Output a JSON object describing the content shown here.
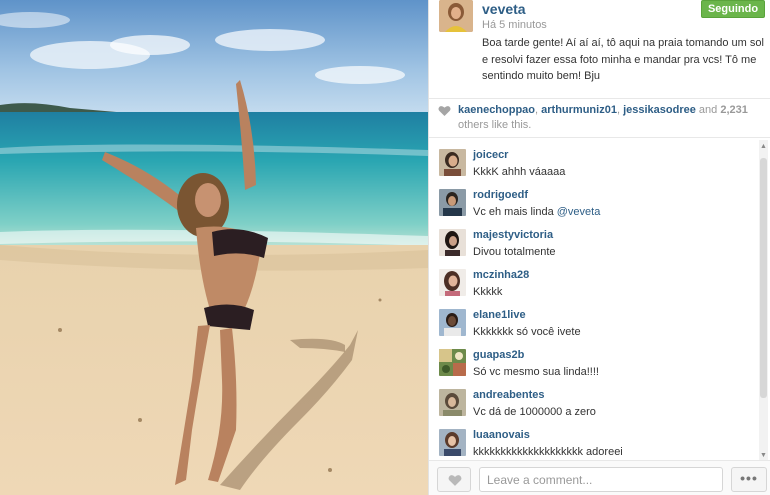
{
  "post": {
    "username": "veveta",
    "time": "Há 5 minutos",
    "follow_label": "Seguindo",
    "caption": "Boa tarde gente! Aí aí aí, tô aqui na praia tomando um sol e resolvi fazer essa foto minha e mandar pra vcs! Tô me sentindo muito bem! Bju"
  },
  "likes": {
    "users": [
      "kaenechoppao",
      "arthurmuniz01",
      "jessikasodree"
    ],
    "sep": ", ",
    "and": " and ",
    "count": "2,231",
    "suffix": " others like this."
  },
  "comments": [
    {
      "user": "joicecr",
      "text": "KkkK ahhh váaaaa",
      "mention": ""
    },
    {
      "user": "rodrigoedf",
      "text": "Vc eh mais linda ",
      "mention": "@veveta"
    },
    {
      "user": "majestyvictoria",
      "text": "Divou totalmente",
      "mention": ""
    },
    {
      "user": "mczinha28",
      "text": "Kkkkk",
      "mention": ""
    },
    {
      "user": "elane1live",
      "text": "Kkkkkkk só você ivete",
      "mention": ""
    },
    {
      "user": "guapas2b",
      "text": "Só vc mesmo sua linda!!!!",
      "mention": ""
    },
    {
      "user": "andreabentes",
      "text": "Vc dá de 1000000 a zero",
      "mention": ""
    },
    {
      "user": "luaanovais",
      "text": "kkkkkkkkkkkkkkkkkkkk adoreei",
      "mention": ""
    }
  ],
  "footer": {
    "comment_placeholder": "Leave a comment...",
    "more_label": "•••"
  },
  "colors": {
    "link": "#2e5e86",
    "follow_green": "#6bb54b"
  }
}
